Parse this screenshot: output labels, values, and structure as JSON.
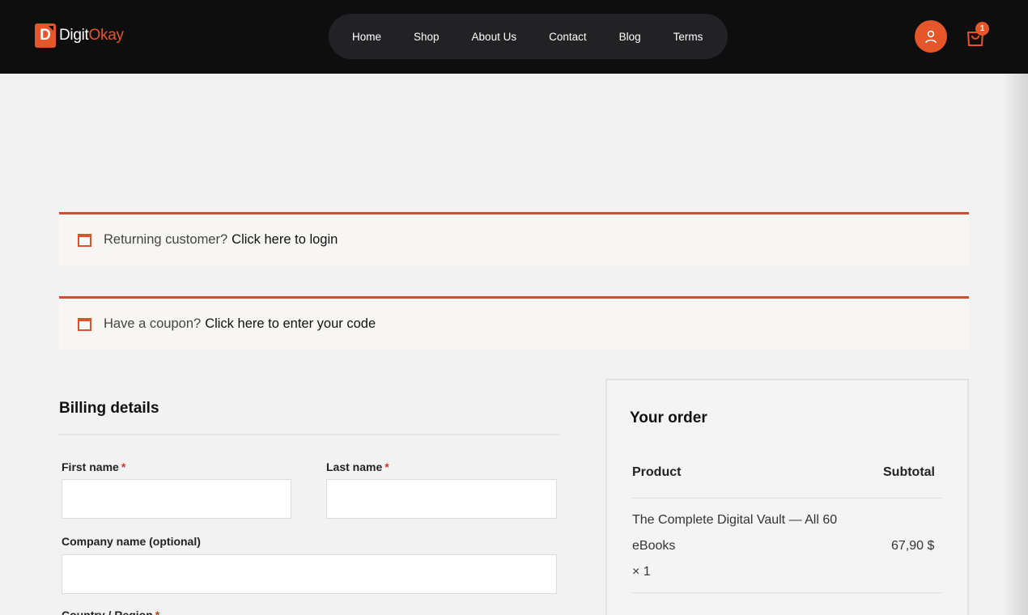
{
  "brand": {
    "name_part1": "Digit",
    "name_part2": "Okay",
    "mark_letter": "D"
  },
  "nav": {
    "items": [
      "Home",
      "Shop",
      "About Us",
      "Contact",
      "Blog",
      "Terms"
    ]
  },
  "header": {
    "cart_count": "1",
    "user_icon": "user-icon",
    "cart_icon": "shopping-bag-icon"
  },
  "notices": {
    "login": {
      "lead": "Returning customer?",
      "link": "Click here to login"
    },
    "coupon": {
      "lead": "Have a coupon?",
      "link": "Click here to enter your code"
    }
  },
  "billing": {
    "title": "Billing details",
    "first_name_label": "First name",
    "last_name_label": "Last name",
    "company_label": "Company name (optional)",
    "country_label": "Country / Region",
    "required_mark": "*",
    "first_name_value": "",
    "last_name_value": "",
    "company_value": ""
  },
  "order": {
    "title": "Your order",
    "col_product": "Product",
    "col_subtotal": "Subtotal",
    "items": [
      {
        "name": "The Complete Digital Vault — All 60 eBooks",
        "qty": "× 1",
        "subtotal": "67,90 $"
      }
    ]
  },
  "colors": {
    "accent": "#e5562a",
    "header_bg": "#0e0e0e",
    "notice_border": "#c9532b"
  }
}
